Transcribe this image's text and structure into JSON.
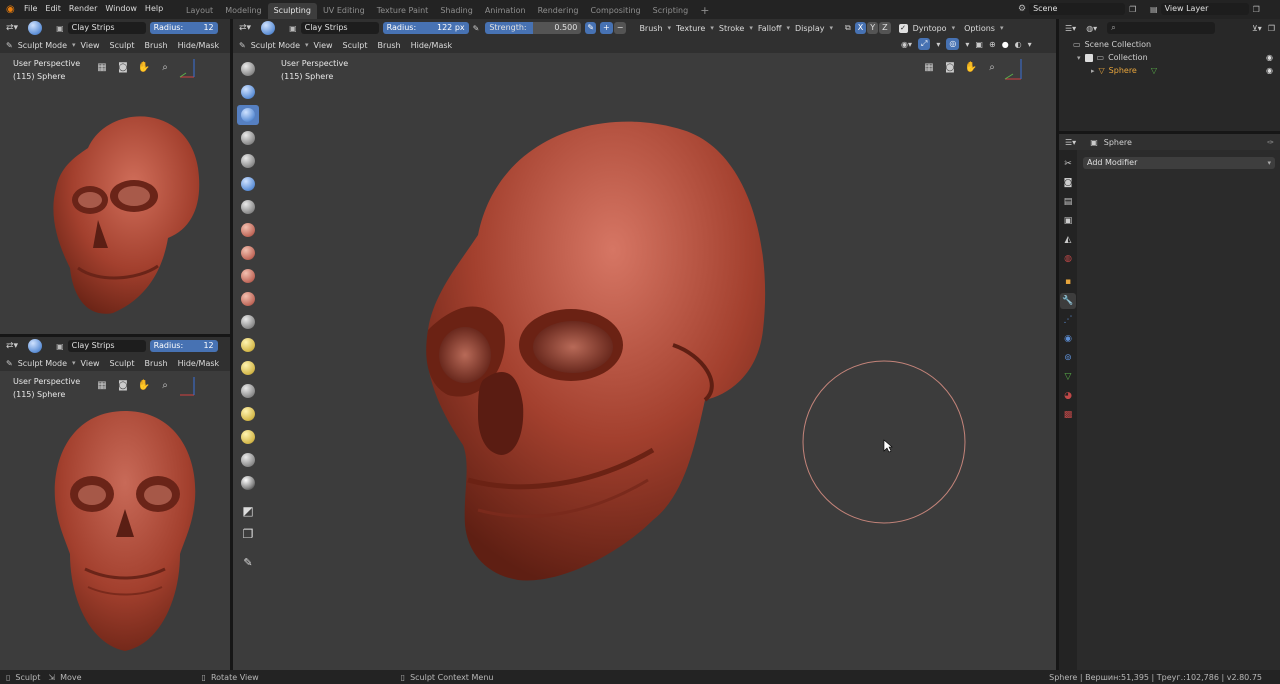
{
  "menu": {
    "items": [
      "File",
      "Edit",
      "Render",
      "Window",
      "Help"
    ]
  },
  "workspaces": [
    "Layout",
    "Modeling",
    "Sculpting",
    "UV Editing",
    "Texture Paint",
    "Shading",
    "Animation",
    "Rendering",
    "Compositing",
    "Scripting"
  ],
  "active_workspace": "Sculpting",
  "scene": {
    "label": "Scene"
  },
  "view_layer": {
    "label": "View Layer"
  },
  "brush": {
    "name": "Clay Strips",
    "radius_label": "Radius:",
    "radius_value": "122 px",
    "radius_short": "12",
    "strength_label": "Strength:",
    "strength_value": "0.500",
    "menus": [
      "Brush",
      "Texture",
      "Stroke",
      "Falloff",
      "Display"
    ],
    "axes": [
      "X",
      "Y",
      "Z"
    ],
    "dyntopo": "Dyntopo",
    "options": "Options"
  },
  "mode": {
    "label": "Sculpt Mode",
    "menus": [
      "View",
      "Sculpt",
      "Brush",
      "Hide/Mask"
    ]
  },
  "viewport": {
    "perspective": "User Perspective",
    "object": "(115) Sphere"
  },
  "outliner": {
    "search_placeholder": "",
    "scene_collection": "Scene Collection",
    "collection": "Collection",
    "object": "Sphere"
  },
  "properties": {
    "object": "Sphere",
    "add_modifier": "Add Modifier"
  },
  "statusbar": {
    "items": [
      "Sculpt",
      "Move",
      "Rotate View",
      "Sculpt Context Menu"
    ],
    "stats": "Sphere | Вершин:51,395 | Треуг.:102,786 | v2.80.75"
  },
  "colors": {
    "accent": "#4772b3",
    "skull": "#a8412e",
    "brush_circle": "#c4847a",
    "outliner_active": "#e8a53c"
  }
}
